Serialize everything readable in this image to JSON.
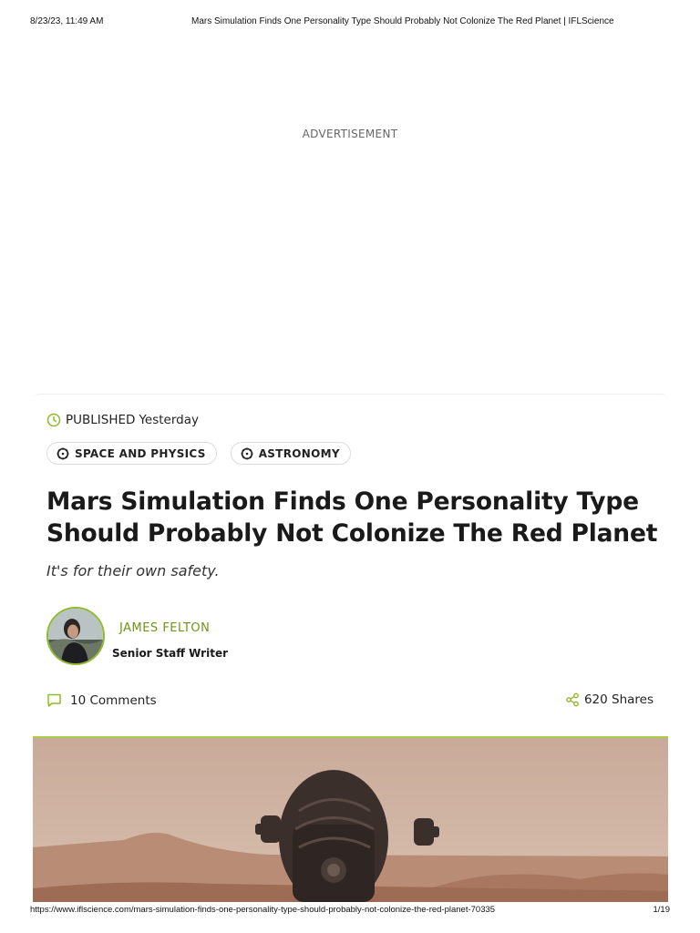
{
  "print_header": {
    "datetime": "8/23/23, 11:49 AM",
    "document_title": "Mars Simulation Finds One Personality Type Should Probably Not Colonize The Red Planet | IFLScience"
  },
  "advertisement": {
    "label": "ADVERTISEMENT"
  },
  "article": {
    "published_label": "PUBLISHED",
    "published_value": "Yesterday",
    "tags": [
      {
        "label": "SPACE AND PHYSICS",
        "icon": "atom-icon"
      },
      {
        "label": "ASTRONOMY",
        "icon": "atom-icon"
      }
    ],
    "headline": "Mars Simulation Finds One Personality Type Should Probably Not Colonize The Red Planet",
    "subtitle": "It's for their own safety.",
    "author": {
      "name": "JAMES FELTON",
      "role": "Senior Staff Writer"
    },
    "comments": "10 Comments",
    "shares": "620 Shares"
  },
  "print_footer": {
    "url": "https://www.iflscience.com/mars-simulation-finds-one-personality-type-should-probably-not-colonize-the-red-planet-70335",
    "page": "1/19"
  },
  "colors": {
    "accent": "#8fba2d",
    "author": "#6f9416"
  }
}
